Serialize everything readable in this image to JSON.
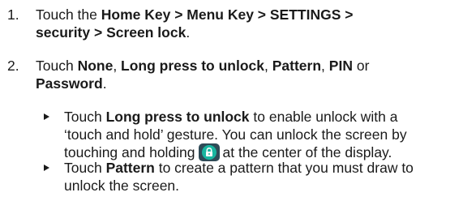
{
  "step1": {
    "number": "1.",
    "lead": "Touch the ",
    "path1": "Home Key > Menu Key > SETTINGS >",
    "path2": "security > Screen lock",
    "end": "."
  },
  "step2": {
    "number": "2.",
    "lead": "Touch ",
    "opt_none": "None",
    "sep1": ", ",
    "opt_long": "Long press to unlock",
    "sep2": ", ",
    "opt_pattern": "Pattern",
    "sep3": ", ",
    "opt_pin": "PIN",
    "sep4": " or",
    "opt_password": "Password",
    "end": "."
  },
  "bullet1": {
    "lead": "Touch ",
    "bold": "Long press to unlock",
    "line1_rest": " to enable unlock with a",
    "line2": "‘touch and hold’ gesture. You can unlock the screen by",
    "line3_pre": "touching and holding",
    "line3_post": "at the center of the display.",
    "icon": "lock-icon"
  },
  "bullet2": {
    "lead": "Touch ",
    "bold": "Pattern",
    "line1_rest": " to create a pattern that you must draw to",
    "line2": "unlock the screen."
  }
}
